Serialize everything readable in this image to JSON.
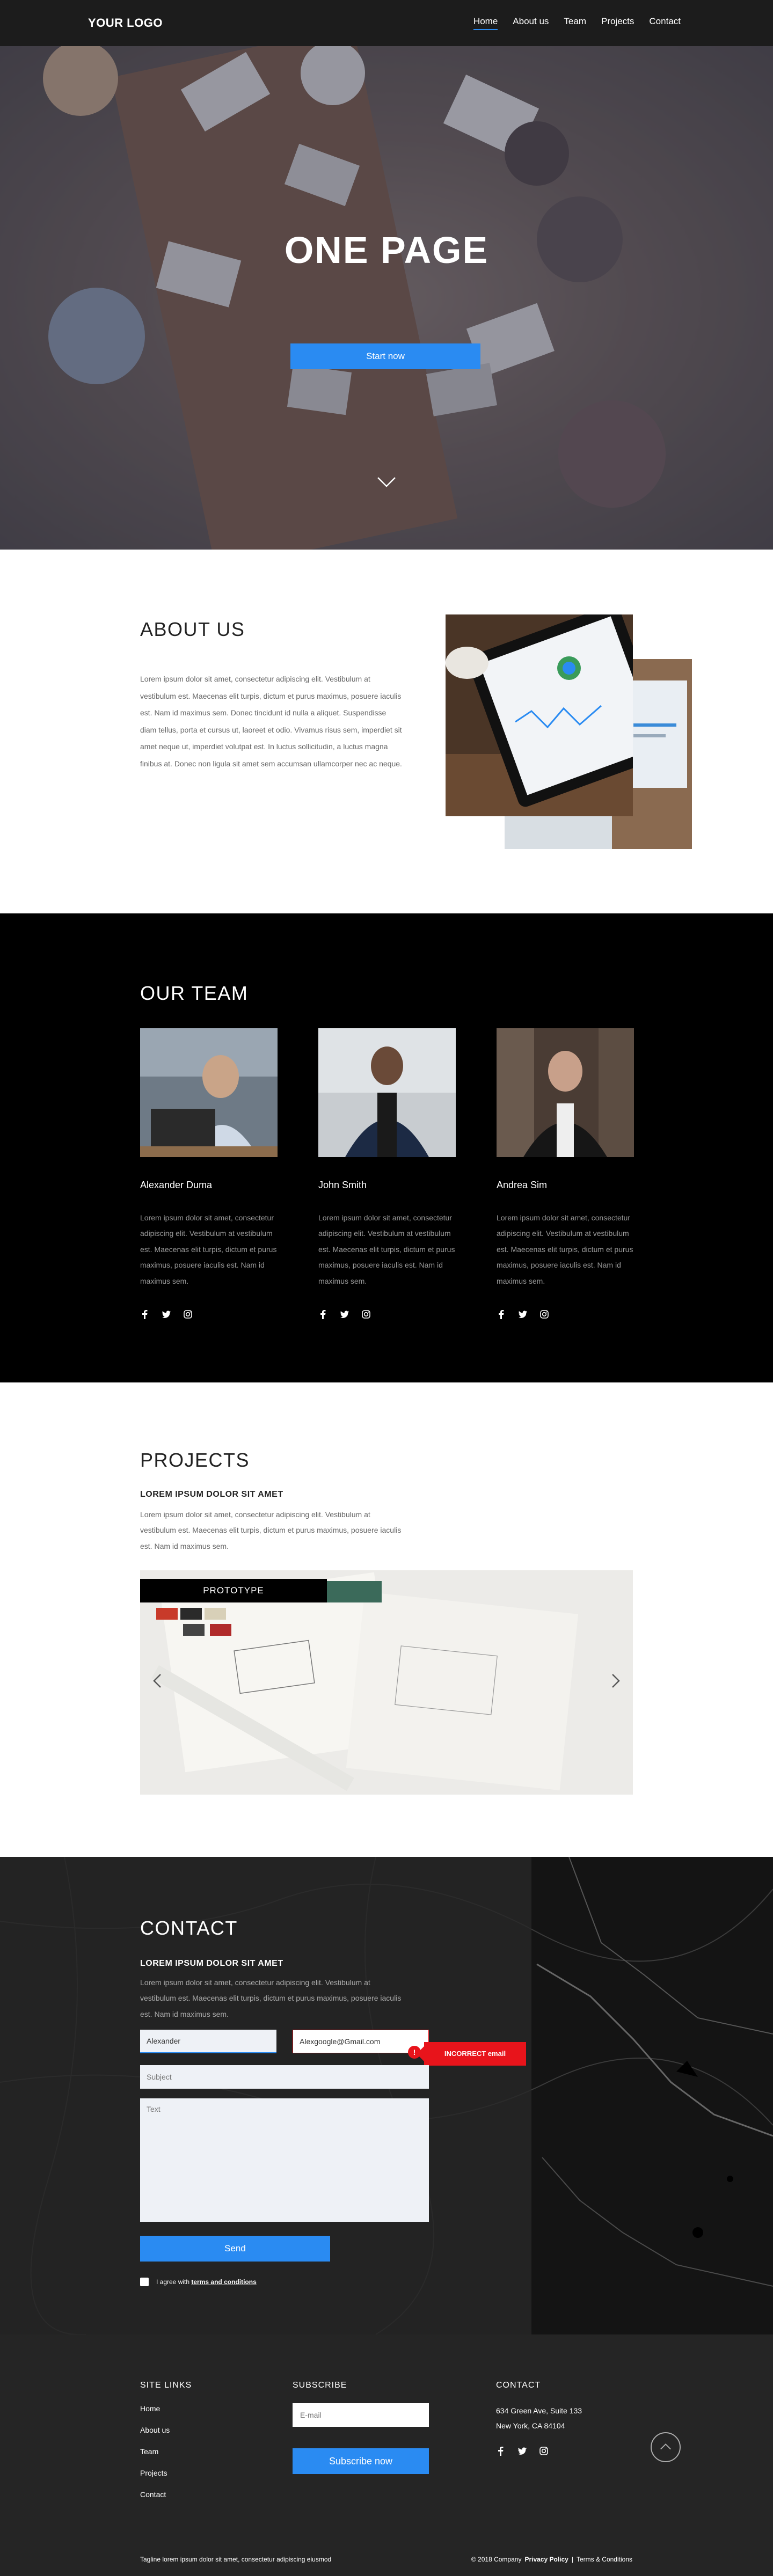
{
  "nav": {
    "logo": "YOUR LOGO",
    "links": [
      "Home",
      "About us",
      "Team",
      "Projects",
      "Contact"
    ],
    "active": "Home"
  },
  "hero": {
    "title": "ONE PAGE",
    "button": "Start now",
    "scroll_icon": "chevron-down-icon"
  },
  "about": {
    "title": "ABOUT US",
    "text": "Lorem ipsum dolor sit amet, consectetur adipiscing elit. Vestibulum at vestibulum est. Maecenas elit turpis, dictum et purus maximus, posuere iaculis est. Nam id maximus sem. Donec tincidunt id nulla a aliquet. Suspendisse diam tellus, porta et cursus ut, laoreet et odio. Vivamus risus sem, imperdiet sit amet neque ut, imperdiet volutpat est. In luctus sollicitudin, a luctus magna finibus at. Donec non ligula sit amet sem accumsan ullamcorper nec ac neque."
  },
  "team": {
    "title": "OUR TEAM",
    "members": [
      {
        "name": "Alexander Duma",
        "bio": "Lorem ipsum dolor sit amet, consectetur adipiscing elit. Vestibulum at vestibulum est. Maecenas elit turpis, dictum et purus maximus, posuere iaculis est. Nam id maximus sem."
      },
      {
        "name": "John Smith",
        "bio": "Lorem ipsum dolor sit amet, consectetur adipiscing elit. Vestibulum at vestibulum est. Maecenas elit turpis, dictum et purus maximus, posuere iaculis est. Nam id maximus sem."
      },
      {
        "name": "Andrea Sim",
        "bio": "Lorem ipsum dolor sit amet, consectetur adipiscing elit. Vestibulum at vestibulum est. Maecenas elit turpis, dictum et purus maximus, posuere iaculis est. Nam id maximus sem."
      }
    ],
    "social_icons": [
      "facebook-icon",
      "twitter-icon",
      "instagram-icon"
    ]
  },
  "projects": {
    "title": "PROJECTS",
    "subtitle": "LOREM IPSUM DOLOR SIT AMET",
    "text": "Lorem ipsum dolor sit amet, consectetur adipiscing elit. Vestibulum at vestibulum est. Maecenas elit turpis, dictum et purus maximus, posuere iaculis est. Nam id maximus sem.",
    "slide_tag": "PROTOTYPE"
  },
  "contact": {
    "title": "CONTACT",
    "subtitle": "LOREM IPSUM DOLOR SIT AMET",
    "text": "Lorem ipsum dolor sit amet, consectetur adipiscing elit. Vestibulum at vestibulum est. Maecenas elit turpis, dictum et purus maximus, posuere iaculis est. Nam id maximus sem.",
    "name_value": "Alexander",
    "email_value": "Alexgoogle@Gmail.com",
    "error_icon": "!",
    "error_message": "INCORRECT email",
    "subject_placeholder": "Subject",
    "text_placeholder": "Text",
    "send": "Send",
    "agree_prefix": "I agree with",
    "agree_link": "terms and conditions"
  },
  "footer": {
    "site_links_title": "SITE LINKS",
    "site_links": [
      "Home",
      "About us",
      "Team",
      "Projects",
      "Contact"
    ],
    "subscribe_title": "SUBSCRIBE",
    "email_placeholder": "E-mail",
    "subscribe_button": "Subscribe now",
    "contact_title": "CONTACT",
    "address_line1": "634 Green Ave, Suite 133",
    "address_line2": "New York, CA 84104",
    "tagline": "Tagline lorem ipsum dolor sit amet, consectetur adipiscing eiusmod",
    "copyright": "© 2018 Company",
    "privacy": "Privacy Policy",
    "separator": "|",
    "terms": "Terms & Conditions"
  },
  "colors": {
    "accent": "#2a8bf2",
    "error": "#e8141b",
    "nav_bg": "#1c1c1c",
    "footer_bg": "#252525"
  }
}
